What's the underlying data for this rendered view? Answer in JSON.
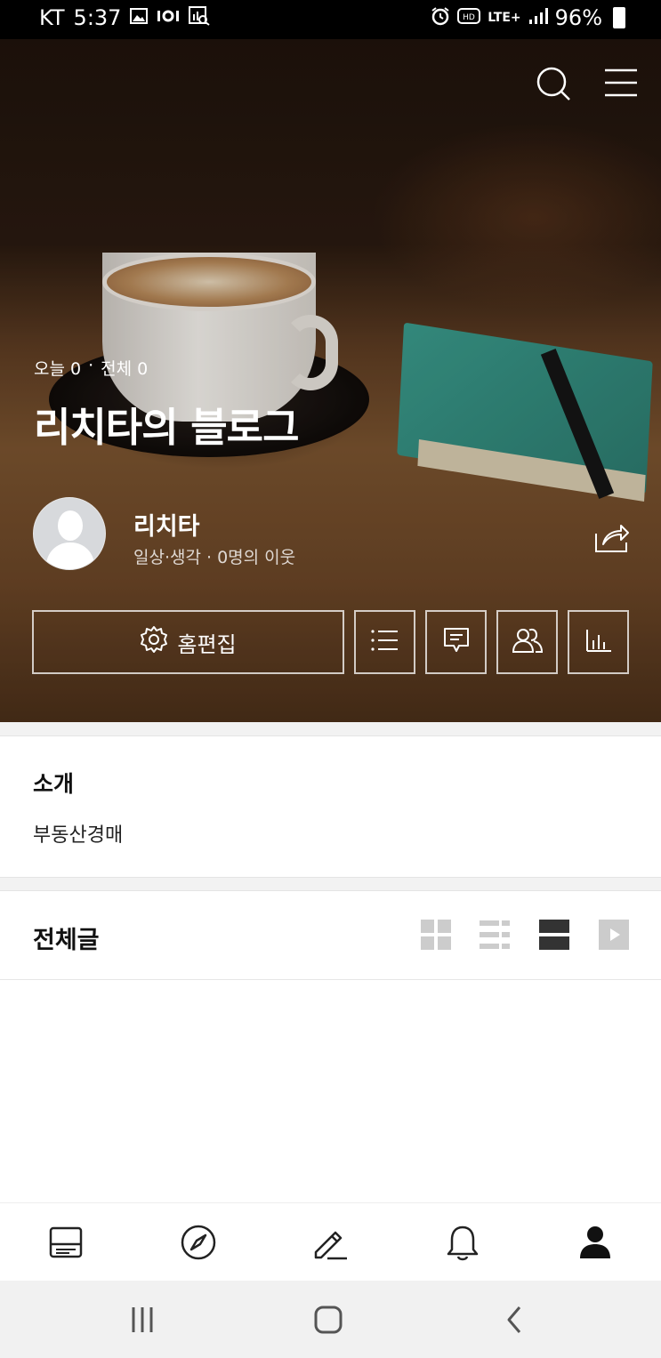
{
  "status_bar": {
    "carrier": "KT",
    "time": "5:37",
    "battery": "96%",
    "network": "LTE+"
  },
  "hero": {
    "stats_today": "오늘 0",
    "stats_sep": "·",
    "stats_total": "전체 0",
    "blog_title": "리치타의 블로그",
    "profile_name": "리치타",
    "profile_meta": "일상·생각 · 0명의 이웃",
    "home_edit_label": "홈편집"
  },
  "intro": {
    "title": "소개",
    "text": "부동산경매"
  },
  "posts": {
    "title": "전체글"
  },
  "colors": {
    "text_dark": "#111111",
    "section_gap": "#f2f2f2",
    "view_icon_active": "#333333",
    "view_icon_inactive": "#cccccc"
  },
  "icons": {
    "top": [
      "search-icon",
      "menu-icon"
    ],
    "buttons": [
      "gear-icon",
      "list-icon",
      "comment-icon",
      "neighbors-icon",
      "stats-icon"
    ],
    "view_modes": [
      "grid-view-icon",
      "list-view-icon",
      "card-view-icon",
      "video-view-icon"
    ],
    "bottom_nav": [
      "feed-icon",
      "compass-icon",
      "write-icon",
      "bell-icon",
      "profile-icon"
    ],
    "system": [
      "recent-apps-icon",
      "home-icon",
      "back-icon"
    ]
  }
}
